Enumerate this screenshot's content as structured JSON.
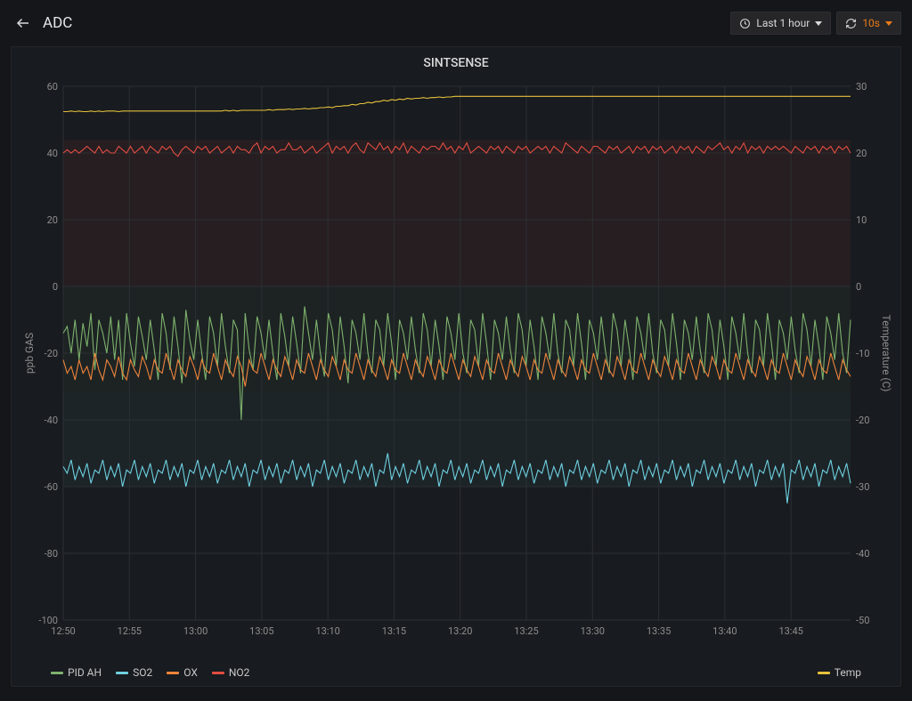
{
  "header": {
    "title": "ADC",
    "time_range_label": "Last 1 hour",
    "refresh_interval": "10s"
  },
  "panel": {
    "title": "SINTSENSE"
  },
  "chart_data": {
    "type": "line",
    "x_label_times": [
      "12:50",
      "12:55",
      "13:00",
      "13:05",
      "13:10",
      "13:15",
      "13:20",
      "13:25",
      "13:30",
      "13:35",
      "13:40",
      "13:45"
    ],
    "left_axis": {
      "label": "ppb GAS",
      "min": -100,
      "max": 60,
      "ticks": [
        -100,
        -80,
        -60,
        -40,
        -20,
        0,
        20,
        40,
        60
      ]
    },
    "right_axis": {
      "label": "Temperature (C)",
      "min": -50,
      "max": 30,
      "ticks": [
        -50,
        -40,
        -30,
        -20,
        -10,
        0,
        10,
        20,
        30
      ]
    },
    "legend_left": [
      {
        "name": "PID AH",
        "color": "#7eb26d"
      },
      {
        "name": "SO2",
        "color": "#6ed0e0"
      },
      {
        "name": "OX",
        "color": "#ef843c"
      },
      {
        "name": "NO2",
        "color": "#e24d42"
      }
    ],
    "legend_right": [
      {
        "name": "Temp",
        "color": "#e5c13c"
      }
    ],
    "series": [
      {
        "name": "NO2",
        "color": "#e24d42",
        "axis": "left",
        "yvals": [
          40,
          41,
          40,
          41,
          40,
          41,
          42,
          41,
          40,
          42,
          40,
          41,
          40,
          40,
          42,
          41,
          40,
          42,
          40,
          41,
          42,
          40,
          42,
          41,
          40,
          42,
          41,
          42,
          40,
          39,
          41,
          42,
          41,
          40,
          42,
          41,
          42,
          40,
          41,
          42,
          40,
          41,
          42,
          40,
          42,
          41,
          41,
          40,
          42,
          43,
          40,
          42,
          41,
          42,
          40,
          41,
          41,
          43,
          41,
          41,
          42,
          40,
          41,
          42,
          40,
          41,
          42,
          43,
          40,
          42,
          41,
          42,
          40,
          42,
          43,
          41,
          40,
          43,
          42,
          41,
          43,
          41,
          42,
          40,
          42,
          41,
          43,
          40,
          42,
          41,
          40,
          42,
          41,
          42,
          42,
          41,
          43,
          41,
          42,
          40,
          42,
          41,
          43,
          40,
          41,
          42,
          41,
          40,
          42,
          41,
          42,
          40,
          42,
          41,
          40,
          42,
          41,
          42,
          40,
          41,
          42,
          41,
          42,
          40,
          42,
          41,
          40,
          43,
          42,
          41,
          40,
          42,
          41,
          40,
          42,
          42,
          41,
          40,
          42,
          41,
          42,
          40,
          41,
          42,
          40,
          42,
          41,
          42,
          40,
          42,
          41,
          42,
          40,
          41,
          42,
          40,
          42,
          41,
          42,
          40,
          42,
          41,
          40,
          42,
          41,
          42,
          43,
          41,
          42,
          40,
          42,
          41,
          43,
          40,
          42,
          41,
          42,
          40,
          42,
          41,
          42,
          41,
          42,
          41,
          40,
          42,
          41,
          40,
          42,
          41,
          42,
          40,
          42,
          41,
          42,
          40,
          42,
          41,
          42,
          40
        ]
      },
      {
        "name": "PID AH",
        "color": "#7eb26d",
        "axis": "left",
        "yvals": [
          -14,
          -12,
          -20,
          -10,
          -22,
          -11,
          -18,
          -8,
          -25,
          -10,
          -14,
          -20,
          -9,
          -22,
          -10,
          -28,
          -8,
          -17,
          -24,
          -9,
          -15,
          -22,
          -10,
          -19,
          -28,
          -8,
          -14,
          -25,
          -9,
          -18,
          -29,
          -7,
          -16,
          -22,
          -10,
          -20,
          -28,
          -9,
          -14,
          -24,
          -8,
          -18,
          -26,
          -10,
          -13,
          -40,
          -8,
          -19,
          -25,
          -9,
          -14,
          -22,
          -10,
          -20,
          -28,
          -8,
          -15,
          -24,
          -9,
          -17,
          -26,
          -6,
          -14,
          -22,
          -10,
          -20,
          -27,
          -8,
          -13,
          -24,
          -9,
          -18,
          -29,
          -10,
          -14,
          -22,
          -8,
          -20,
          -26,
          -10,
          -13,
          -24,
          -8,
          -17,
          -28,
          -10,
          -14,
          -22,
          -9,
          -19,
          -26,
          -8,
          -13,
          -24,
          -10,
          -18,
          -28,
          -9,
          -14,
          -22,
          -8,
          -20,
          -26,
          -10,
          -13,
          -24,
          -8,
          -17,
          -28,
          -10,
          -14,
          -22,
          -9,
          -19,
          -26,
          -8,
          -13,
          -24,
          -10,
          -18,
          -28,
          -9,
          -14,
          -22,
          -8,
          -20,
          -26,
          -10,
          -13,
          -24,
          -8,
          -17,
          -28,
          -10,
          -14,
          -22,
          -9,
          -19,
          -26,
          -8,
          -13,
          -24,
          -10,
          -18,
          -28,
          -9,
          -14,
          -22,
          -8,
          -20,
          -26,
          -10,
          -13,
          -24,
          -8,
          -17,
          -28,
          -10,
          -14,
          -22,
          -9,
          -19,
          -26,
          -8,
          -13,
          -24,
          -10,
          -18,
          -28,
          -9,
          -14,
          -22,
          -8,
          -20,
          -26,
          -10,
          -13,
          -24,
          -8,
          -17,
          -28,
          -10,
          -14,
          -22,
          -9,
          -19,
          -26,
          -8,
          -13,
          -24,
          -10,
          -18,
          -28,
          -9,
          -14,
          -22,
          -8,
          -20,
          -26,
          -10
        ]
      },
      {
        "name": "OX",
        "color": "#ef843c",
        "axis": "left",
        "yvals": [
          -22,
          -26,
          -24,
          -28,
          -22,
          -26,
          -24,
          -28,
          -20,
          -25,
          -28,
          -22,
          -24,
          -27,
          -21,
          -26,
          -28,
          -22,
          -25,
          -27,
          -21,
          -24,
          -28,
          -22,
          -25,
          -26,
          -20,
          -24,
          -28,
          -22,
          -25,
          -27,
          -21,
          -24,
          -28,
          -22,
          -25,
          -26,
          -20,
          -24,
          -28,
          -22,
          -25,
          -27,
          -21,
          -24,
          -30,
          -22,
          -25,
          -26,
          -20,
          -24,
          -28,
          -22,
          -25,
          -27,
          -21,
          -24,
          -28,
          -22,
          -25,
          -26,
          -20,
          -24,
          -28,
          -22,
          -25,
          -27,
          -21,
          -24,
          -28,
          -22,
          -25,
          -26,
          -20,
          -24,
          -28,
          -22,
          -25,
          -27,
          -21,
          -24,
          -28,
          -22,
          -25,
          -26,
          -20,
          -24,
          -28,
          -22,
          -25,
          -27,
          -21,
          -24,
          -28,
          -22,
          -25,
          -26,
          -20,
          -24,
          -28,
          -22,
          -25,
          -27,
          -21,
          -24,
          -28,
          -22,
          -25,
          -26,
          -20,
          -24,
          -28,
          -22,
          -25,
          -27,
          -21,
          -24,
          -28,
          -22,
          -25,
          -26,
          -20,
          -24,
          -28,
          -22,
          -25,
          -27,
          -21,
          -24,
          -28,
          -22,
          -25,
          -26,
          -20,
          -24,
          -28,
          -22,
          -25,
          -27,
          -21,
          -24,
          -28,
          -22,
          -25,
          -26,
          -20,
          -24,
          -28,
          -22,
          -25,
          -27,
          -21,
          -24,
          -28,
          -22,
          -25,
          -26,
          -20,
          -24,
          -28,
          -22,
          -25,
          -27,
          -21,
          -24,
          -28,
          -22,
          -25,
          -26,
          -20,
          -24,
          -28,
          -22,
          -25,
          -27,
          -21,
          -24,
          -28,
          -22,
          -25,
          -26,
          -20,
          -24,
          -28,
          -22,
          -25,
          -27,
          -21,
          -24,
          -28,
          -22,
          -25,
          -26,
          -20,
          -24,
          -28,
          -22,
          -25,
          -27
        ]
      },
      {
        "name": "SO2",
        "color": "#6ed0e0",
        "axis": "left",
        "yvals": [
          -54,
          -56,
          -52,
          -58,
          -54,
          -57,
          -53,
          -59,
          -55,
          -56,
          -52,
          -58,
          -54,
          -57,
          -53,
          -60,
          -55,
          -56,
          -52,
          -58,
          -54,
          -57,
          -53,
          -59,
          -55,
          -56,
          -52,
          -58,
          -54,
          -57,
          -53,
          -60,
          -55,
          -56,
          -52,
          -58,
          -54,
          -57,
          -53,
          -59,
          -55,
          -56,
          -52,
          -58,
          -54,
          -57,
          -53,
          -60,
          -55,
          -56,
          -52,
          -58,
          -54,
          -57,
          -53,
          -59,
          -55,
          -56,
          -52,
          -58,
          -54,
          -57,
          -53,
          -60,
          -55,
          -56,
          -52,
          -58,
          -54,
          -57,
          -53,
          -59,
          -55,
          -56,
          -52,
          -58,
          -54,
          -57,
          -53,
          -60,
          -55,
          -56,
          -50,
          -58,
          -54,
          -57,
          -53,
          -59,
          -55,
          -56,
          -52,
          -58,
          -54,
          -57,
          -53,
          -60,
          -55,
          -56,
          -52,
          -58,
          -54,
          -57,
          -53,
          -59,
          -55,
          -56,
          -52,
          -58,
          -54,
          -57,
          -53,
          -60,
          -55,
          -56,
          -52,
          -58,
          -54,
          -57,
          -53,
          -59,
          -55,
          -56,
          -52,
          -58,
          -54,
          -57,
          -53,
          -60,
          -55,
          -56,
          -52,
          -58,
          -54,
          -57,
          -53,
          -59,
          -55,
          -56,
          -52,
          -58,
          -54,
          -57,
          -53,
          -60,
          -55,
          -56,
          -52,
          -58,
          -54,
          -57,
          -53,
          -59,
          -55,
          -56,
          -52,
          -58,
          -54,
          -57,
          -53,
          -60,
          -55,
          -56,
          -52,
          -58,
          -54,
          -57,
          -53,
          -59,
          -55,
          -56,
          -52,
          -58,
          -54,
          -57,
          -53,
          -60,
          -55,
          -56,
          -52,
          -58,
          -54,
          -57,
          -53,
          -65,
          -55,
          -56,
          -52,
          -58,
          -54,
          -57,
          -53,
          -60,
          -55,
          -56,
          -52,
          -58,
          -54,
          -57,
          -53,
          -59
        ]
      },
      {
        "name": "Temp",
        "color": "#e5c13c",
        "axis": "right",
        "yvals": [
          26.2,
          26.2,
          26.3,
          26.2,
          26.3,
          26.2,
          26.2,
          26.3,
          26.2,
          26.3,
          26.2,
          26.3,
          26.3,
          26.3,
          26.2,
          26.3,
          26.3,
          26.3,
          26.3,
          26.3,
          26.3,
          26.3,
          26.3,
          26.3,
          26.3,
          26.3,
          26.3,
          26.3,
          26.3,
          26.3,
          26.3,
          26.3,
          26.3,
          26.3,
          26.3,
          26.3,
          26.3,
          26.3,
          26.3,
          26.3,
          26.3,
          26.4,
          26.3,
          26.4,
          26.3,
          26.4,
          26.4,
          26.4,
          26.4,
          26.4,
          26.4,
          26.4,
          26.5,
          26.4,
          26.5,
          26.5,
          26.5,
          26.6,
          26.5,
          26.6,
          26.6,
          26.7,
          26.6,
          26.7,
          26.7,
          26.8,
          26.8,
          26.9,
          26.8,
          27.0,
          27.0,
          27.1,
          27.1,
          27.3,
          27.2,
          27.4,
          27.4,
          27.6,
          27.5,
          27.7,
          27.7,
          27.9,
          27.8,
          28.0,
          27.9,
          28.1,
          28.0,
          28.2,
          28.1,
          28.2,
          28.2,
          28.3,
          28.2,
          28.3,
          28.3,
          28.4,
          28.3,
          28.4,
          28.4,
          28.5,
          28.5,
          28.5,
          28.5,
          28.5,
          28.5,
          28.5,
          28.5,
          28.5,
          28.5,
          28.5,
          28.5,
          28.5,
          28.5,
          28.5,
          28.5,
          28.5,
          28.5,
          28.5,
          28.5,
          28.5,
          28.5,
          28.5,
          28.5,
          28.5,
          28.5,
          28.5,
          28.5,
          28.5,
          28.5,
          28.5,
          28.5,
          28.5,
          28.5,
          28.5,
          28.5,
          28.5,
          28.5,
          28.5,
          28.5,
          28.5,
          28.5,
          28.5,
          28.5,
          28.5,
          28.5,
          28.5,
          28.5,
          28.5,
          28.5,
          28.5,
          28.5,
          28.5,
          28.5,
          28.5,
          28.5,
          28.5,
          28.5,
          28.5,
          28.5,
          28.5,
          28.5,
          28.5,
          28.5,
          28.5,
          28.5,
          28.5,
          28.5,
          28.5,
          28.5,
          28.5,
          28.5,
          28.5,
          28.5,
          28.5,
          28.5,
          28.5,
          28.5,
          28.5,
          28.5,
          28.5,
          28.5,
          28.5,
          28.5,
          28.5,
          28.5,
          28.5,
          28.5,
          28.5,
          28.5,
          28.5,
          28.5,
          28.5,
          28.5,
          28.5,
          28.5,
          28.5,
          28.5,
          28.5,
          28.5,
          28.5
        ]
      }
    ],
    "region_fills": [
      {
        "color": "#e24d42",
        "opacity": 0.07,
        "y_from": 0,
        "y_to": 44,
        "axis": "left"
      },
      {
        "color": "#7eb26d",
        "opacity": 0.06,
        "y_from": -32,
        "y_to": 0,
        "axis": "left"
      },
      {
        "color": "#6ed0e0",
        "opacity": 0.05,
        "y_from": -60,
        "y_to": -32,
        "axis": "left"
      }
    ]
  }
}
